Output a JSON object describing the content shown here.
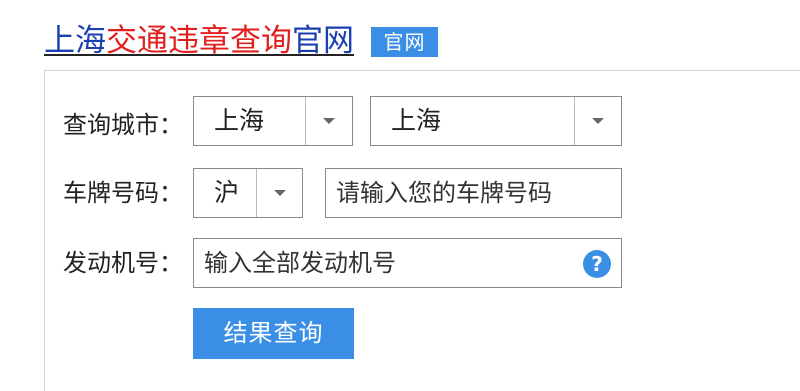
{
  "header": {
    "title_part1": "上海",
    "title_part2": "交通违章查询",
    "title_part3": "官网",
    "badge": "官网"
  },
  "form": {
    "city_label": "查询城市：",
    "city_province": "上海",
    "city_city": "上海",
    "plate_label": "车牌号码：",
    "plate_prefix": "沪",
    "plate_placeholder": "请输入您的车牌号码",
    "engine_label": "发动机号：",
    "engine_placeholder": "输入全部发动机号",
    "help_icon": "?",
    "submit_label": "结果查询"
  },
  "colors": {
    "title_blue": "#1a3fb0",
    "title_red": "#e0201e",
    "accent": "#3a8ee6"
  }
}
